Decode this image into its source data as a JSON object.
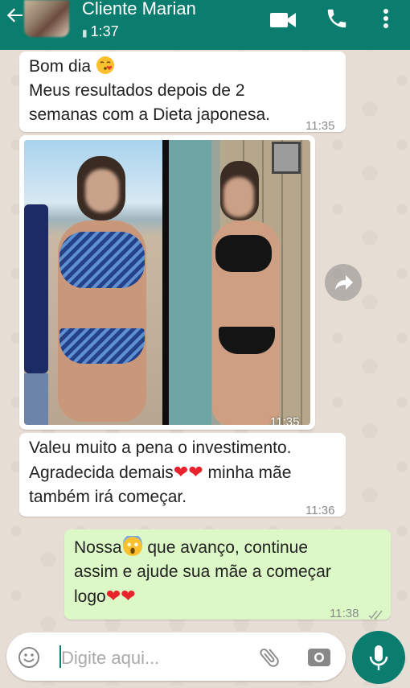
{
  "header": {
    "contact_name": "Cliente Marian",
    "status": "1:37",
    "icons": [
      "back-arrow-icon",
      "video-call-icon",
      "phone-icon",
      "more-vert-icon"
    ]
  },
  "messages": [
    {
      "type": "text",
      "direction": "in",
      "lines": [
        "Bom dia",
        "Meus resultados depois de 2",
        "semanas com a Dieta japonesa."
      ],
      "emoji": "kissing-heart-emoji",
      "time": "11:35"
    },
    {
      "type": "image",
      "direction": "in",
      "time": "11:35"
    },
    {
      "type": "text",
      "direction": "in",
      "lines": [
        "Valeu muito a pena o investimento.",
        "Agradecida demais",
        "minha mãe",
        "também irá começar."
      ],
      "time": "11:36"
    },
    {
      "type": "text",
      "direction": "out",
      "lines": [
        "Nossa",
        "que avanço, continue",
        "assim e ajude sua mãe a começar",
        "logo"
      ],
      "emoji": "scream-emoji",
      "time": "11:38"
    }
  ],
  "composer": {
    "placeholder": "Digite aqui..."
  },
  "colors": {
    "header": "#0a7d6f",
    "outgoing_bubble": "#dcf8c6",
    "incoming_bubble": "#ffffff",
    "chat_background": "#e6ddd4"
  }
}
